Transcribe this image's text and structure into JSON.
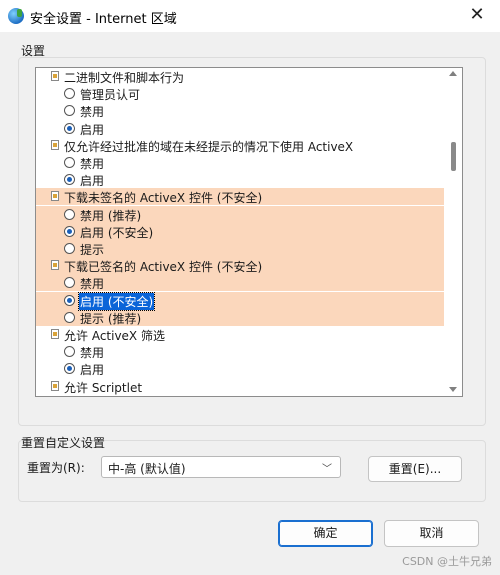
{
  "window": {
    "title": "安全设置 - Internet 区域",
    "close_glyph": "✕"
  },
  "settings": {
    "group_label": "设置",
    "rows": [
      {
        "kind": "heading",
        "label": "二进制文件和脚本行为"
      },
      {
        "kind": "option",
        "label": "管理员认可",
        "checked": false
      },
      {
        "kind": "option",
        "label": "禁用",
        "checked": false
      },
      {
        "kind": "option",
        "label": "启用",
        "checked": true
      },
      {
        "kind": "heading",
        "label": "仅允许经过批准的域在未经提示的情况下使用 ActiveX"
      },
      {
        "kind": "option",
        "label": "禁用",
        "checked": false
      },
      {
        "kind": "option",
        "label": "启用",
        "checked": true
      },
      {
        "kind": "heading",
        "label": "下载未签名的 ActiveX 控件 (不安全)",
        "highlight": true
      },
      {
        "kind": "option",
        "label": "禁用 (推荐)",
        "checked": false,
        "highlight": true
      },
      {
        "kind": "option",
        "label": "启用 (不安全)",
        "checked": true,
        "highlight": true
      },
      {
        "kind": "option",
        "label": "提示",
        "checked": false,
        "highlight": true
      },
      {
        "kind": "heading",
        "label": "下载已签名的 ActiveX 控件 (不安全)",
        "highlight": true
      },
      {
        "kind": "option",
        "label": "禁用",
        "checked": false,
        "highlight": true
      },
      {
        "kind": "option",
        "label": "启用 (不安全)",
        "checked": true,
        "highlight": true,
        "selected": true
      },
      {
        "kind": "option",
        "label": "提示 (推荐)",
        "checked": false,
        "highlight": true
      },
      {
        "kind": "heading",
        "label": "允许 ActiveX 筛选"
      },
      {
        "kind": "option",
        "label": "禁用",
        "checked": false
      },
      {
        "kind": "option",
        "label": "启用",
        "checked": true
      },
      {
        "kind": "heading",
        "label": "允许 Scriptlet"
      }
    ]
  },
  "reset": {
    "group_label": "重置自定义设置",
    "to_label": "重置为(R):",
    "select_value": "中-高 (默认值)",
    "button_label": "重置(E)..."
  },
  "buttons": {
    "ok": "确定",
    "cancel": "取消"
  },
  "watermark": "CSDN @土牛兄弟"
}
